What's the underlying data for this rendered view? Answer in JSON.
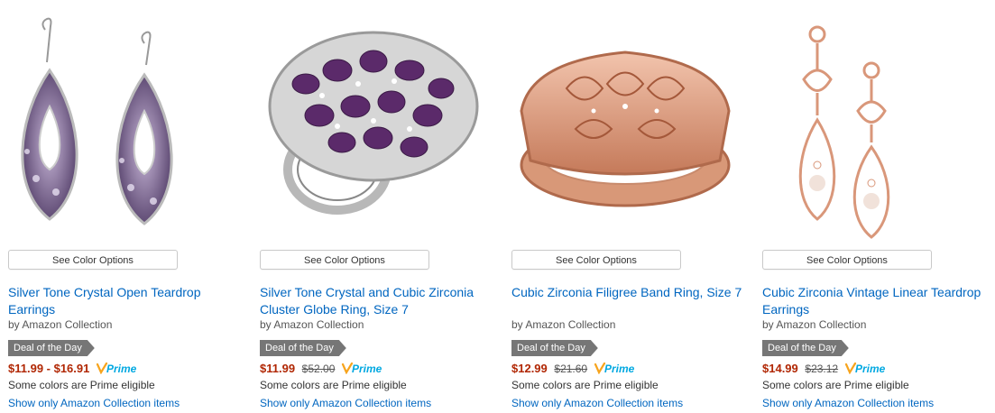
{
  "products": [
    {
      "image_alt": "earrings-teardrop",
      "color_options_label": "See Color Options",
      "title": "Silver Tone Crystal Open Teardrop Earrings",
      "by_prefix": "by",
      "brand": "Amazon Collection",
      "deal_label": "Deal of the Day",
      "price": "$11.99 - $16.91",
      "list_price": "",
      "prime_label": "Prime",
      "prime_note": "Some colors are Prime eligible",
      "show_only_label": "Show only Amazon Collection items"
    },
    {
      "image_alt": "ring-cluster-globe",
      "color_options_label": "See Color Options",
      "title": "Silver Tone Crystal and Cubic Zirconia Cluster Globe Ring, Size 7",
      "by_prefix": "by",
      "brand": "Amazon Collection",
      "deal_label": "Deal of the Day",
      "price": "$11.99",
      "list_price": "$52.00",
      "prime_label": "Prime",
      "prime_note": "Some colors are Prime eligible",
      "show_only_label": "Show only Amazon Collection items"
    },
    {
      "image_alt": "ring-filigree-band",
      "color_options_label": "See Color Options",
      "title": "Cubic Zirconia Filigree Band Ring, Size 7",
      "by_prefix": "by",
      "brand": "Amazon Collection",
      "deal_label": "Deal of the Day",
      "price": "$12.99",
      "list_price": "$21.60",
      "prime_label": "Prime",
      "prime_note": "Some colors are Prime eligible",
      "show_only_label": "Show only Amazon Collection items"
    },
    {
      "image_alt": "earrings-vintage-linear",
      "color_options_label": "See Color Options",
      "title": "Cubic Zirconia Vintage Linear Teardrop Earrings",
      "by_prefix": "by",
      "brand": "Amazon Collection",
      "deal_label": "Deal of the Day",
      "price": "$14.99",
      "list_price": "$23.12",
      "prime_label": "Prime",
      "prime_note": "Some colors are Prime eligible",
      "show_only_label": "Show only Amazon Collection items"
    }
  ],
  "colors": {
    "link": "#0066c0",
    "price": "#b12704",
    "deal_badge": "#767676",
    "prime_blue": "#00a8e1",
    "prime_orange": "#f7a41d"
  }
}
